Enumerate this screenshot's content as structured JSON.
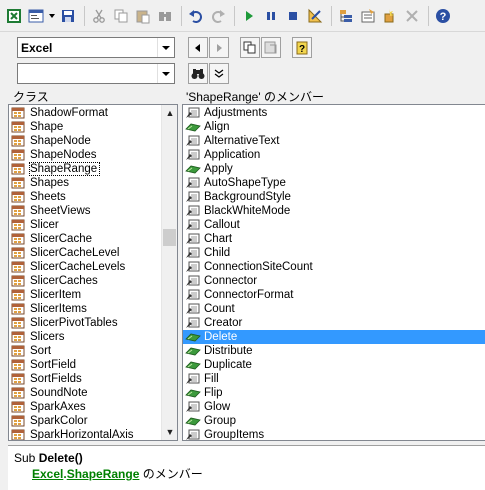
{
  "toolbar": {
    "buttons": [
      "excel-view-icon",
      "insert-module-icon",
      "save-icon",
      "cut-icon",
      "copy-icon",
      "paste-icon",
      "find-icon",
      "undo-icon",
      "redo-icon",
      "run-icon",
      "break-icon",
      "reset-icon",
      "design-mode-icon",
      "project-explorer-icon",
      "properties-icon",
      "object-browser-icon",
      "toolbox-icon",
      "help-icon"
    ]
  },
  "library_combo": {
    "value": "Excel"
  },
  "search_combo": {
    "value": ""
  },
  "classes_header": "クラス",
  "members_header": "'ShapeRange' のメンバー",
  "classes": [
    "ShadowFormat",
    "Shape",
    "ShapeNode",
    "ShapeNodes",
    "ShapeRange",
    "Shapes",
    "Sheets",
    "SheetViews",
    "Slicer",
    "SlicerCache",
    "SlicerCacheLevel",
    "SlicerCacheLevels",
    "SlicerCaches",
    "SlicerItem",
    "SlicerItems",
    "SlicerPivotTables",
    "Slicers",
    "Sort",
    "SortField",
    "SortFields",
    "SoundNote",
    "SparkAxes",
    "SparkColor",
    "SparkHorizontalAxis"
  ],
  "selected_class_index": 4,
  "members": [
    {
      "name": "Adjustments",
      "kind": "property"
    },
    {
      "name": "Align",
      "kind": "method"
    },
    {
      "name": "AlternativeText",
      "kind": "property"
    },
    {
      "name": "Application",
      "kind": "property"
    },
    {
      "name": "Apply",
      "kind": "method"
    },
    {
      "name": "AutoShapeType",
      "kind": "property"
    },
    {
      "name": "BackgroundStyle",
      "kind": "property"
    },
    {
      "name": "BlackWhiteMode",
      "kind": "property"
    },
    {
      "name": "Callout",
      "kind": "property"
    },
    {
      "name": "Chart",
      "kind": "property"
    },
    {
      "name": "Child",
      "kind": "property"
    },
    {
      "name": "ConnectionSiteCount",
      "kind": "property"
    },
    {
      "name": "Connector",
      "kind": "property"
    },
    {
      "name": "ConnectorFormat",
      "kind": "property"
    },
    {
      "name": "Count",
      "kind": "property"
    },
    {
      "name": "Creator",
      "kind": "property"
    },
    {
      "name": "Delete",
      "kind": "method"
    },
    {
      "name": "Distribute",
      "kind": "method"
    },
    {
      "name": "Duplicate",
      "kind": "method"
    },
    {
      "name": "Fill",
      "kind": "property"
    },
    {
      "name": "Flip",
      "kind": "method"
    },
    {
      "name": "Glow",
      "kind": "property"
    },
    {
      "name": "Group",
      "kind": "method"
    },
    {
      "name": "GroupItems",
      "kind": "property"
    }
  ],
  "selected_member_index": 16,
  "detail": {
    "prefix": "Sub ",
    "name": "Delete()",
    "library": "Excel",
    "dot": ".",
    "class": "ShapeRange",
    "suffix": " のメンバー"
  },
  "colors": {
    "selection": "#3399ff",
    "link": "#008000",
    "method_icon": "#3c9a3c",
    "property_icon": "#555555"
  }
}
